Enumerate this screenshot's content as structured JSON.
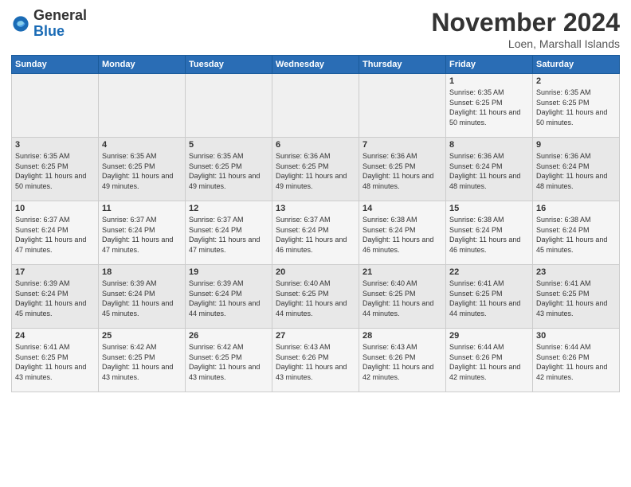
{
  "header": {
    "logo_line1": "General",
    "logo_line2": "Blue",
    "month_title": "November 2024",
    "location": "Loen, Marshall Islands"
  },
  "days_of_week": [
    "Sunday",
    "Monday",
    "Tuesday",
    "Wednesday",
    "Thursday",
    "Friday",
    "Saturday"
  ],
  "weeks": [
    [
      {
        "day": "",
        "sunrise": "",
        "sunset": "",
        "daylight": ""
      },
      {
        "day": "",
        "sunrise": "",
        "sunset": "",
        "daylight": ""
      },
      {
        "day": "",
        "sunrise": "",
        "sunset": "",
        "daylight": ""
      },
      {
        "day": "",
        "sunrise": "",
        "sunset": "",
        "daylight": ""
      },
      {
        "day": "",
        "sunrise": "",
        "sunset": "",
        "daylight": ""
      },
      {
        "day": "1",
        "sunrise": "Sunrise: 6:35 AM",
        "sunset": "Sunset: 6:25 PM",
        "daylight": "Daylight: 11 hours and 50 minutes."
      },
      {
        "day": "2",
        "sunrise": "Sunrise: 6:35 AM",
        "sunset": "Sunset: 6:25 PM",
        "daylight": "Daylight: 11 hours and 50 minutes."
      }
    ],
    [
      {
        "day": "3",
        "sunrise": "Sunrise: 6:35 AM",
        "sunset": "Sunset: 6:25 PM",
        "daylight": "Daylight: 11 hours and 50 minutes."
      },
      {
        "day": "4",
        "sunrise": "Sunrise: 6:35 AM",
        "sunset": "Sunset: 6:25 PM",
        "daylight": "Daylight: 11 hours and 49 minutes."
      },
      {
        "day": "5",
        "sunrise": "Sunrise: 6:35 AM",
        "sunset": "Sunset: 6:25 PM",
        "daylight": "Daylight: 11 hours and 49 minutes."
      },
      {
        "day": "6",
        "sunrise": "Sunrise: 6:36 AM",
        "sunset": "Sunset: 6:25 PM",
        "daylight": "Daylight: 11 hours and 49 minutes."
      },
      {
        "day": "7",
        "sunrise": "Sunrise: 6:36 AM",
        "sunset": "Sunset: 6:25 PM",
        "daylight": "Daylight: 11 hours and 48 minutes."
      },
      {
        "day": "8",
        "sunrise": "Sunrise: 6:36 AM",
        "sunset": "Sunset: 6:24 PM",
        "daylight": "Daylight: 11 hours and 48 minutes."
      },
      {
        "day": "9",
        "sunrise": "Sunrise: 6:36 AM",
        "sunset": "Sunset: 6:24 PM",
        "daylight": "Daylight: 11 hours and 48 minutes."
      }
    ],
    [
      {
        "day": "10",
        "sunrise": "Sunrise: 6:37 AM",
        "sunset": "Sunset: 6:24 PM",
        "daylight": "Daylight: 11 hours and 47 minutes."
      },
      {
        "day": "11",
        "sunrise": "Sunrise: 6:37 AM",
        "sunset": "Sunset: 6:24 PM",
        "daylight": "Daylight: 11 hours and 47 minutes."
      },
      {
        "day": "12",
        "sunrise": "Sunrise: 6:37 AM",
        "sunset": "Sunset: 6:24 PM",
        "daylight": "Daylight: 11 hours and 47 minutes."
      },
      {
        "day": "13",
        "sunrise": "Sunrise: 6:37 AM",
        "sunset": "Sunset: 6:24 PM",
        "daylight": "Daylight: 11 hours and 46 minutes."
      },
      {
        "day": "14",
        "sunrise": "Sunrise: 6:38 AM",
        "sunset": "Sunset: 6:24 PM",
        "daylight": "Daylight: 11 hours and 46 minutes."
      },
      {
        "day": "15",
        "sunrise": "Sunrise: 6:38 AM",
        "sunset": "Sunset: 6:24 PM",
        "daylight": "Daylight: 11 hours and 46 minutes."
      },
      {
        "day": "16",
        "sunrise": "Sunrise: 6:38 AM",
        "sunset": "Sunset: 6:24 PM",
        "daylight": "Daylight: 11 hours and 45 minutes."
      }
    ],
    [
      {
        "day": "17",
        "sunrise": "Sunrise: 6:39 AM",
        "sunset": "Sunset: 6:24 PM",
        "daylight": "Daylight: 11 hours and 45 minutes."
      },
      {
        "day": "18",
        "sunrise": "Sunrise: 6:39 AM",
        "sunset": "Sunset: 6:24 PM",
        "daylight": "Daylight: 11 hours and 45 minutes."
      },
      {
        "day": "19",
        "sunrise": "Sunrise: 6:39 AM",
        "sunset": "Sunset: 6:24 PM",
        "daylight": "Daylight: 11 hours and 44 minutes."
      },
      {
        "day": "20",
        "sunrise": "Sunrise: 6:40 AM",
        "sunset": "Sunset: 6:25 PM",
        "daylight": "Daylight: 11 hours and 44 minutes."
      },
      {
        "day": "21",
        "sunrise": "Sunrise: 6:40 AM",
        "sunset": "Sunset: 6:25 PM",
        "daylight": "Daylight: 11 hours and 44 minutes."
      },
      {
        "day": "22",
        "sunrise": "Sunrise: 6:41 AM",
        "sunset": "Sunset: 6:25 PM",
        "daylight": "Daylight: 11 hours and 44 minutes."
      },
      {
        "day": "23",
        "sunrise": "Sunrise: 6:41 AM",
        "sunset": "Sunset: 6:25 PM",
        "daylight": "Daylight: 11 hours and 43 minutes."
      }
    ],
    [
      {
        "day": "24",
        "sunrise": "Sunrise: 6:41 AM",
        "sunset": "Sunset: 6:25 PM",
        "daylight": "Daylight: 11 hours and 43 minutes."
      },
      {
        "day": "25",
        "sunrise": "Sunrise: 6:42 AM",
        "sunset": "Sunset: 6:25 PM",
        "daylight": "Daylight: 11 hours and 43 minutes."
      },
      {
        "day": "26",
        "sunrise": "Sunrise: 6:42 AM",
        "sunset": "Sunset: 6:25 PM",
        "daylight": "Daylight: 11 hours and 43 minutes."
      },
      {
        "day": "27",
        "sunrise": "Sunrise: 6:43 AM",
        "sunset": "Sunset: 6:26 PM",
        "daylight": "Daylight: 11 hours and 43 minutes."
      },
      {
        "day": "28",
        "sunrise": "Sunrise: 6:43 AM",
        "sunset": "Sunset: 6:26 PM",
        "daylight": "Daylight: 11 hours and 42 minutes."
      },
      {
        "day": "29",
        "sunrise": "Sunrise: 6:44 AM",
        "sunset": "Sunset: 6:26 PM",
        "daylight": "Daylight: 11 hours and 42 minutes."
      },
      {
        "day": "30",
        "sunrise": "Sunrise: 6:44 AM",
        "sunset": "Sunset: 6:26 PM",
        "daylight": "Daylight: 11 hours and 42 minutes."
      }
    ]
  ]
}
